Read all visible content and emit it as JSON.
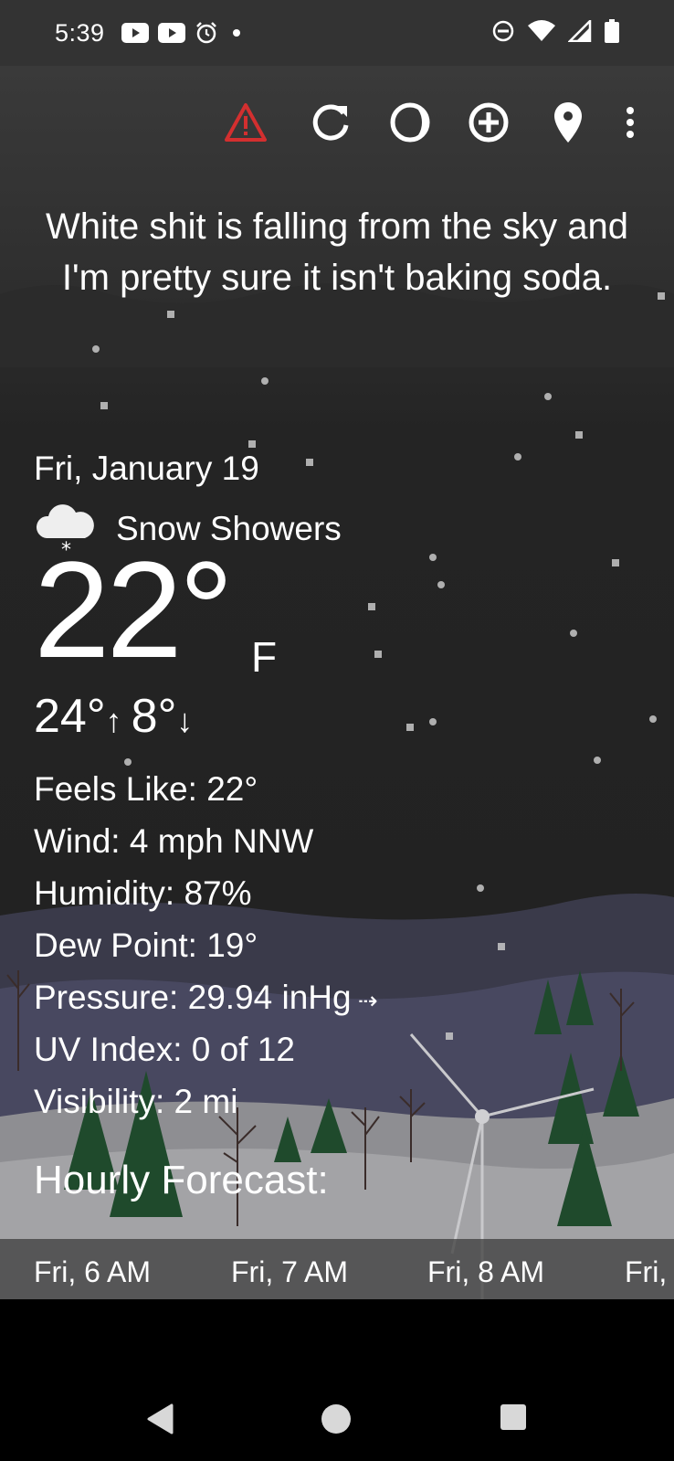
{
  "status_bar": {
    "time": "5:39",
    "left_icons": [
      "youtube-icon",
      "youtube-icon",
      "alarm-icon",
      "dot-icon"
    ],
    "right_icons": [
      "dnd-icon",
      "wifi-icon",
      "signal-icon",
      "battery-icon"
    ]
  },
  "toolbar": {
    "buttons": [
      "alert-icon",
      "refresh-icon",
      "theme-icon",
      "add-location-icon",
      "location-pin-icon",
      "more-vert-icon"
    ],
    "alert_color": "#d32f2f"
  },
  "quote": "White shit is falling from the sky and I'm pretty sure it isn't baking soda.",
  "current": {
    "date": "Fri, January 19",
    "condition": "Snow Showers",
    "condition_icon": "snow-cloud-icon",
    "temperature": "22°",
    "unit": "F",
    "high": "24°",
    "low": "8°",
    "details": [
      "Feels Like:  22°",
      "Wind:  4 mph NNW",
      "Humidity:  87%",
      "Dew Point:  19°",
      "Pressure:  29.94 inHg",
      "UV Index:  0 of 12",
      "Visibility:  2 mi"
    ]
  },
  "hourly": {
    "title": "Hourly Forecast:",
    "items": [
      "Fri, 6 AM",
      "Fri, 7 AM",
      "Fri, 8 AM",
      "Fri,"
    ]
  },
  "nav_bar": [
    "back-icon",
    "home-icon",
    "recents-icon"
  ]
}
